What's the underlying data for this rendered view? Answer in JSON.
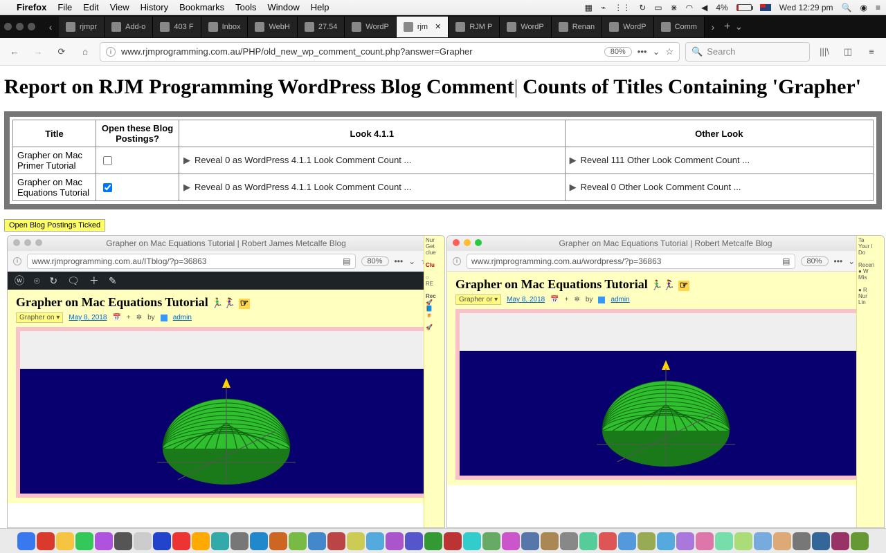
{
  "menubar": {
    "app": "Firefox",
    "items": [
      "File",
      "Edit",
      "View",
      "History",
      "Bookmarks",
      "Tools",
      "Window",
      "Help"
    ],
    "battery": "4%",
    "clock": "Wed 12:29 pm"
  },
  "tabs": [
    {
      "label": "rjmpr"
    },
    {
      "label": "Add-o"
    },
    {
      "label": "403 F"
    },
    {
      "label": "Inbox"
    },
    {
      "label": "WebH"
    },
    {
      "label": "27.54"
    },
    {
      "label": "WordP"
    },
    {
      "label": "rjm",
      "active": true
    },
    {
      "label": "RJM P"
    },
    {
      "label": "WordP"
    },
    {
      "label": "Renan"
    },
    {
      "label": "WordP"
    },
    {
      "label": "Comm"
    }
  ],
  "urlbar": {
    "url": "www.rjmprogramming.com.au/PHP/old_new_wp_comment_count.php?answer=Grapher",
    "zoom": "80%",
    "search_placeholder": "Search"
  },
  "report": {
    "heading_before": "Report on RJM Programming WordPress Blog Comment",
    "heading_after": " Counts of Titles Containing 'Grapher'",
    "columns": [
      "Title",
      "Open these Blog Postings?",
      "Look 4.1.1",
      "Other Look"
    ],
    "rows": [
      {
        "title": "Grapher on Mac Primer Tutorial",
        "checked": false,
        "look": "Reveal 0 as WordPress 4.1.1 Look Comment Count ...",
        "other": "Reveal 111 Other Look Comment Count ..."
      },
      {
        "title": "Grapher on Mac Equations Tutorial",
        "checked": true,
        "look": "Reveal 0 as WordPress 4.1.1 Look Comment Count ...",
        "other": "Reveal 0 Other Look Comment Count ..."
      }
    ],
    "open_button": "Open Blog Postings Ticked"
  },
  "left_window": {
    "title": "Grapher on Mac Equations Tutorial | Robert James Metcalfe Blog",
    "url": "www.rjmprogramming.com.au/ITblog/?p=36863",
    "zoom": "80%",
    "post_title": "Grapher on Mac Equations Tutorial",
    "tag": "Grapher on ▾",
    "date": "May 8, 2018",
    "bylabel": "by",
    "author": "admin",
    "dot_colors": [
      "#bbb",
      "#bbb",
      "#bbb"
    ],
    "has_wpbar": true
  },
  "right_window": {
    "title": "Grapher on Mac Equations Tutorial | Robert Metcalfe Blog",
    "url": "www.rjmprogramming.com.au/wordpress/?p=36863",
    "zoom": "80%",
    "post_title": "Grapher on Mac Equations Tutorial",
    "tag": "Grapher or ▾",
    "date": "May 8, 2018",
    "bylabel": "by",
    "author": "admin",
    "dot_colors": [
      "#ff5f57",
      "#febc2e",
      "#28c840"
    ],
    "has_wpbar": false
  },
  "dock_colors": [
    "#3a78f0",
    "#d93a2b",
    "#f5c542",
    "#34c759",
    "#af52de",
    "#555",
    "#ccc",
    "#24c",
    "#e33",
    "#fa0",
    "#3aa",
    "#777",
    "#28c",
    "#c62",
    "#7b4",
    "#48c",
    "#b44",
    "#cc5",
    "#5ad",
    "#a5c",
    "#55c",
    "#393",
    "#b33",
    "#3cc",
    "#6a6",
    "#c5c",
    "#57a",
    "#a85",
    "#888",
    "#5c9",
    "#d55",
    "#59d",
    "#9a5",
    "#5ad",
    "#a7d",
    "#d7a",
    "#7da",
    "#ad7",
    "#7ad",
    "#da7",
    "#777",
    "#369",
    "#936",
    "#693"
  ]
}
